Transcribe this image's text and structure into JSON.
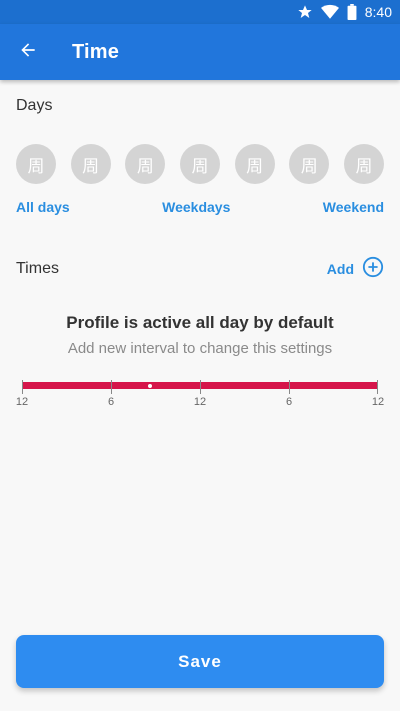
{
  "status_bar": {
    "time": "8:40",
    "icons": [
      "star-icon",
      "wifi-icon",
      "battery-icon"
    ]
  },
  "app_bar": {
    "title": "Time",
    "back_icon": "arrow-left-icon"
  },
  "days": {
    "label": "Days",
    "items": [
      "周",
      "周",
      "周",
      "周",
      "周",
      "周",
      "周"
    ],
    "presets": [
      "All days",
      "Weekdays",
      "Weekend"
    ]
  },
  "times": {
    "label": "Times",
    "add_label": "Add",
    "add_icon": "plus-circle-icon"
  },
  "info": {
    "title": "Profile is active all day by default",
    "subtitle": "Add new interval to change this settings"
  },
  "timeline": {
    "tick_labels": [
      "12",
      "6",
      "12",
      "6",
      "12"
    ],
    "current_time_fraction": 0.36
  },
  "save_label": "Save",
  "colors": {
    "app_bar": "#2176dc",
    "status_bar": "#1c6fcf",
    "accent": "#2a8ee0",
    "timeline": "#d6154a",
    "save_button": "#2e8cf0",
    "day_circle": "#d4d4d4"
  }
}
